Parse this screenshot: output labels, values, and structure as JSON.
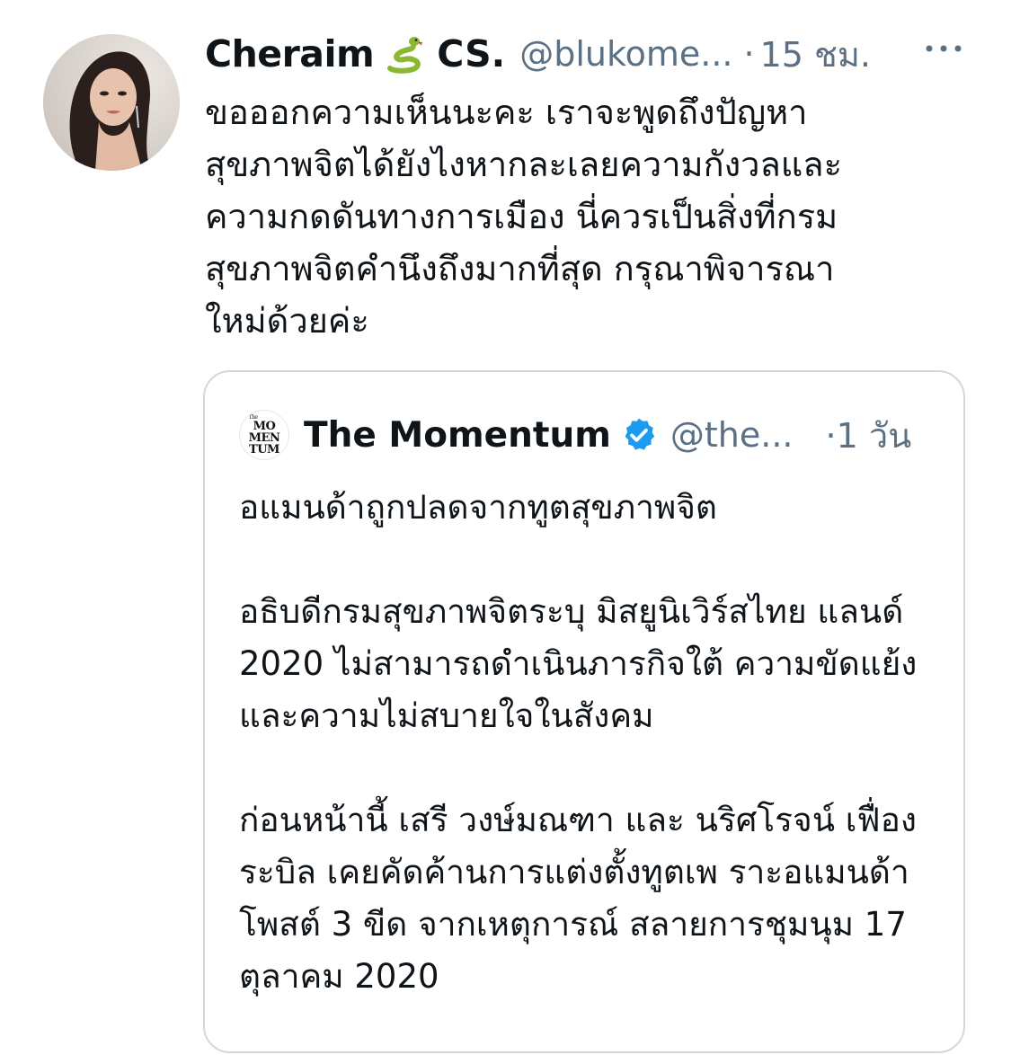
{
  "tweet": {
    "display_name": "Cheraim",
    "display_name_suffix": "CS.",
    "handle": "@blukome...",
    "separator": "·",
    "time": "15 ชม.",
    "emoji_icon": "snake-emoji-icon",
    "text": "ขอออกความเห็นนะคะ เราจะพูดถึงปัญหา\nสุขภาพจิตได้ยังไงหากละเลยความกังวลและ\nความกดดันทางการเมือง นี่ควรเป็นสิ่งที่กรม\nสุขภาพจิตคำนึงถึงมากที่สุด กรุณาพิจารณา\nใหม่ด้วยค่ะ"
  },
  "quote": {
    "logo_lines": [
      "The",
      "MO",
      "MEN",
      "TUM"
    ],
    "name": "The Momentum",
    "handle": "@the...",
    "separator": "·",
    "time": "1 วัน",
    "paragraphs": [
      "อแมนด้าถูกปลดจากทูตสุขภาพจิต",
      "อธิบดีกรมสุขภาพจิตระบุ มิสยูนิเวิร์สไทย แลนด์ 2020 ไม่สามารถดำเนินภารกิจใต้ ความขัดแย้งและความไม่สบายใจในสังคม",
      "ก่อนหน้านี้ เสรี วงษ์มณฑา และ นริศโรจน์ เฟื่องระบิล เคยคัดค้านการแต่งตั้งทูตเพ ราะอแมนด้าโพสต์ 3 ขีด จากเหตุการณ์ สลายการชุมนุม 17 ตุลาคม 2020"
    ]
  },
  "colors": {
    "text_primary": "#0f1419",
    "text_secondary": "#5b7083",
    "card_border": "#cfd9de",
    "verified_blue": "#1d9bf0",
    "snake_green": "#8ab832"
  }
}
